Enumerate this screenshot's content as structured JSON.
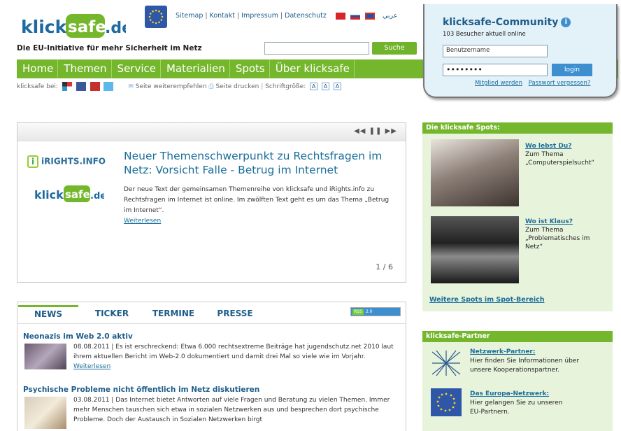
{
  "header": {
    "logo": "klicksafe.de",
    "toplinks": [
      "Sitemap",
      "Kontakt",
      "Impressum",
      "Datenschutz"
    ],
    "arabic": "عربي",
    "tagline": "Die EU-Initiative für mehr Sicherheit im Netz",
    "search_button": "Suche",
    "search_value": ""
  },
  "nav": [
    "Home",
    "Themen",
    "Service",
    "Materialien",
    "Spots",
    "Über klicksafe"
  ],
  "share": {
    "label": "klicksafe bei:",
    "recommend": "Seite weiterempfehlen",
    "print": "Seite drucken",
    "fontsize_label": "Schriftgröße:",
    "sizes": [
      "A",
      "A",
      "A"
    ]
  },
  "community": {
    "title": "klicksafe-Community",
    "online": "103 Besucher aktuell online",
    "username_placeholder": "Benutzername",
    "password_value": "••••••••",
    "login": "login",
    "register": "Mitglied werden",
    "forgot": "Passwort vergessen?"
  },
  "slider": {
    "controls": "◀◀  ❚❚  ▶▶",
    "partner_logo": "iRIGHTS.INFO",
    "title": "Neuer Themenschwerpunkt zu Rechtsfragen im Netz: Vorsicht Falle - Betrug im Internet",
    "text": "Der neue Text der gemeinsamen Themenreihe von klicksafe und iRights.info zu Rechtsfragen im Internet ist online. Im zwölften Text geht es um das Thema „Betrug im Internet“.",
    "more": "Weiterlesen",
    "counter": "1 / 6"
  },
  "news": {
    "tabs": [
      "NEWS",
      "TICKER",
      "TERMINE",
      "PRESSE"
    ],
    "rss": [
      "RSS",
      "2.0"
    ],
    "items": [
      {
        "title": "Neonazis im Web 2.0 aktiv",
        "text": "08.08.2011 | Es ist erschreckend: Etwa 6.000 rechtsextreme Beiträge hat jugendschutz.net 2010 laut ihrem aktuellen Bericht im Web-2.0 dokumentiert und damit drei Mal so viele wie im Vorjahr.",
        "more": "Weiterlesen"
      },
      {
        "title": "Psychische Probleme nicht öffentlich im Netz diskutieren",
        "text": "03.08.2011 | Das Internet bietet Antworten auf viele Fragen und Beratung zu vielen Themen. Immer mehr Menschen tauschen sich etwa in sozialen Netzwerken aus und besprechen dort psychische Probleme. Doch der Austausch in Sozialen Netzwerken birgt"
      }
    ]
  },
  "spots": {
    "title": "Die klicksafe Spots:",
    "items": [
      {
        "link": "Wo lebst Du?",
        "line1": "Zum Thema",
        "line2": "„Computerspielsucht“"
      },
      {
        "link": "Wo ist Klaus?",
        "line1": "Zum Thema",
        "line2": "„Problematisches im",
        "line3": "Netz“"
      }
    ],
    "more": "Weitere Spots im Spot-Bereich"
  },
  "partner": {
    "title": "klicksafe-Partner",
    "items": [
      {
        "link": "Netzwerk-Partner:",
        "line1": "Hier finden Sie Informationen über",
        "line2": "unsere Kooperationspartner."
      },
      {
        "link": "Das Europa-Netzwerk:",
        "line1": "Hier gelangen Sie zu unseren",
        "line2": "EU-Partnern."
      }
    ]
  }
}
